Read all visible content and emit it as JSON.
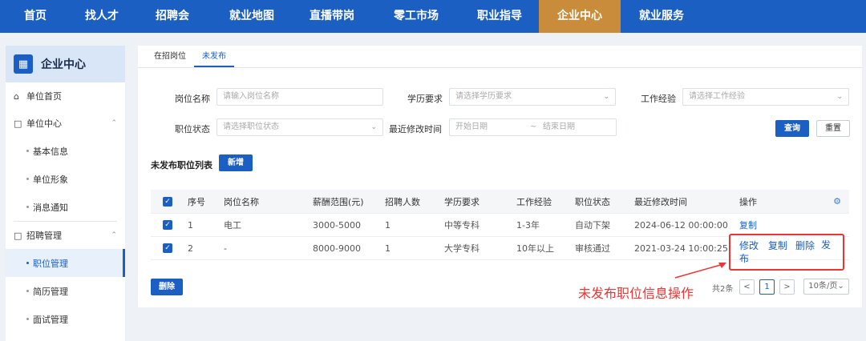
{
  "topnav": {
    "items": [
      {
        "label": "首页",
        "active": false
      },
      {
        "label": "找人才",
        "active": false
      },
      {
        "label": "招聘会",
        "active": false
      },
      {
        "label": "就业地图",
        "active": false
      },
      {
        "label": "直播带岗",
        "active": false
      },
      {
        "label": "零工市场",
        "active": false
      },
      {
        "label": "职业指导",
        "active": false
      },
      {
        "label": "企业中心",
        "active": true
      },
      {
        "label": "就业服务",
        "active": false
      }
    ]
  },
  "sidebar": {
    "title": "企业中心",
    "home": "单位首页",
    "group1": "单位中心",
    "group1_items": [
      "基本信息",
      "单位形象",
      "消息通知"
    ],
    "group2": "招聘管理",
    "group2_items": [
      "职位管理",
      "简历管理",
      "面试管理"
    ]
  },
  "tabs": [
    {
      "label": "在招岗位",
      "active": false
    },
    {
      "label": "未发布",
      "active": true
    }
  ],
  "filters": {
    "post_name_label": "岗位名称",
    "post_name_placeholder": "请输入岗位名称",
    "edu_label": "学历要求",
    "edu_placeholder": "请选择学历要求",
    "exp_label": "工作经验",
    "exp_placeholder": "请选择工作经验",
    "status_label": "职位状态",
    "status_placeholder": "请选择职位状态",
    "modtime_label": "最近修改时间",
    "start_placeholder": "开始日期",
    "range_sep": "~",
    "end_placeholder": "结束日期",
    "query_button": "查询",
    "reset_button": "重置"
  },
  "list": {
    "title": "未发布职位列表",
    "add_button": "新增",
    "columns": [
      "序号",
      "岗位名称",
      "薪酬范围(元)",
      "招聘人数",
      "学历要求",
      "工作经验",
      "职位状态",
      "最近修改时间",
      "操作"
    ],
    "rows": [
      {
        "no": "1",
        "name": "电工",
        "salary": "3000-5000",
        "count": "1",
        "edu": "中等专科",
        "exp": "1-3年",
        "status": "自动下架",
        "time": "2024-06-12 00:00:00",
        "actions": [
          "复制"
        ]
      },
      {
        "no": "2",
        "name": "-",
        "salary": "8000-9000",
        "count": "1",
        "edu": "大学专科",
        "exp": "10年以上",
        "status": "审核通过",
        "time": "2021-03-24 10:00:25",
        "actions": [
          "修改",
          "复制",
          "删除",
          "发布"
        ]
      }
    ],
    "delete_button": "删除"
  },
  "pager": {
    "total": "共2条",
    "prev": "<",
    "page": "1",
    "next": ">",
    "size": "10条/页"
  },
  "annotation": "未发布职位信息操作",
  "colors": {
    "primary": "#1b5fc3",
    "nav_active": "#c98c3a",
    "highlight": "#ee3333"
  }
}
